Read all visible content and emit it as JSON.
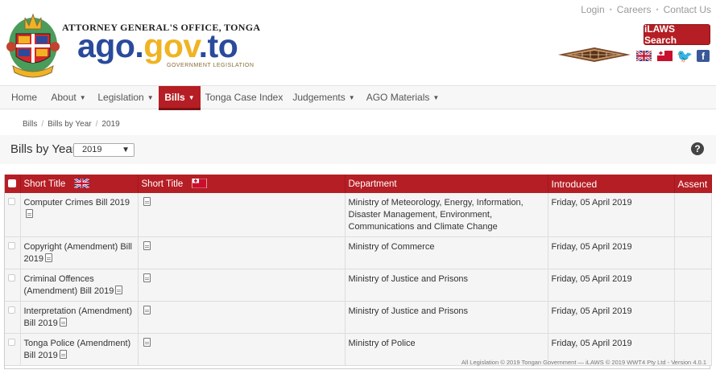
{
  "header": {
    "org_name": "ATTORNEY GENERAL'S OFFICE, TONGA",
    "site_name_part1": "ago.",
    "site_name_part2": "gov",
    "site_name_part3": ".to",
    "site_sub": "GOVERNMENT LEGISLATION",
    "top_links": [
      "Login",
      "Careers",
      "Contact Us"
    ],
    "search_button": "iLAWS Search"
  },
  "nav": {
    "items": [
      {
        "label": "Home",
        "dropdown": false
      },
      {
        "label": "About",
        "dropdown": true
      },
      {
        "label": "Legislation",
        "dropdown": true
      },
      {
        "label": "Bills",
        "dropdown": true,
        "active": true
      },
      {
        "label": "Tonga Case Index",
        "dropdown": false
      },
      {
        "label": "Judgements",
        "dropdown": true
      },
      {
        "label": "AGO Materials",
        "dropdown": true
      }
    ]
  },
  "breadcrumb": [
    "Bills",
    "Bills by Year",
    "2019"
  ],
  "page": {
    "title": "Bills by Year",
    "year_selected": "2019",
    "help": "?"
  },
  "table": {
    "columns": [
      "Short Title",
      "Short Title",
      "Department",
      "Introduced",
      "Assent"
    ],
    "rows": [
      {
        "title_en": "Computer Crimes Bill 2019",
        "department": "Ministry of Meteorology, Energy, Information, Disaster Management, Environment, Communications and Climate Change",
        "introduced": "Friday, 05 April 2019",
        "assent": ""
      },
      {
        "title_en": "Copyright (Amendment) Bill 2019",
        "department": "Ministry of Commerce",
        "introduced": "Friday, 05 April 2019",
        "assent": ""
      },
      {
        "title_en": "Criminal Offences (Amendment) Bill 2019",
        "department": "Ministry of Justice and Prisons",
        "introduced": "Friday, 05 April 2019",
        "assent": ""
      },
      {
        "title_en": "Interpretation (Amendment) Bill 2019",
        "department": "Ministry of Justice and Prisons",
        "introduced": "Friday, 05 April 2019",
        "assent": ""
      },
      {
        "title_en": "Tonga Police (Amendment) Bill 2019",
        "department": "Ministry of Police",
        "introduced": "Friday, 05 April 2019",
        "assent": ""
      }
    ],
    "footer": "All Legislation © 2019 Tongan Government — iLAWS © 2019 WWT4 Pty Ltd - Version 4.0.1"
  },
  "colors": {
    "brand_red": "#b51e24",
    "brand_blue": "#2a4a9b",
    "brand_gold": "#f0b323"
  },
  "icons": [
    "coat-of-arms-icon",
    "uk-flag-icon",
    "tonga-flag-icon",
    "twitter-icon",
    "facebook-icon",
    "pdf-icon",
    "help-icon",
    "checkbox-icon"
  ]
}
